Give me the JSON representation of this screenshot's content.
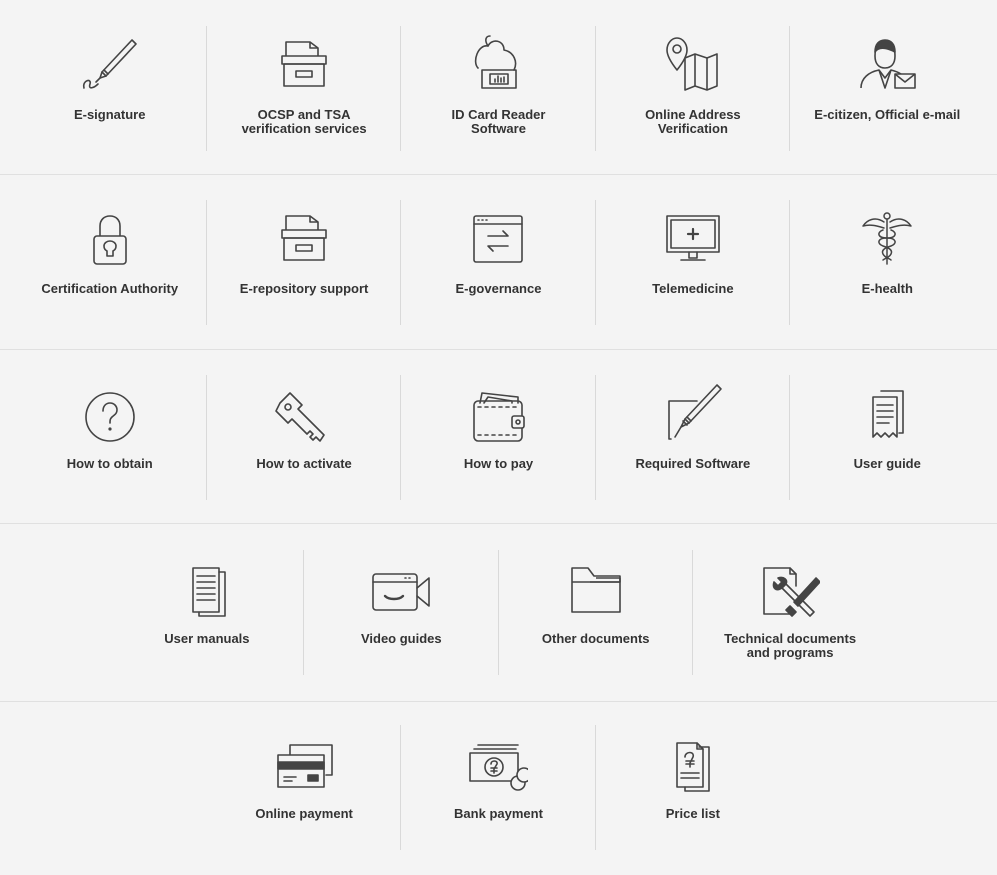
{
  "rows": [
    {
      "items": [
        {
          "label": "E-signature",
          "icon": "pen-signature-icon"
        },
        {
          "label": "OCSP and TSA verification services",
          "icon": "archive-box-icon"
        },
        {
          "label": "ID Card Reader Software",
          "icon": "card-reader-icon"
        },
        {
          "label": "Online Address Verification",
          "icon": "map-pin-icon"
        },
        {
          "label": "E-citizen, Official e-mail",
          "icon": "user-mail-icon"
        }
      ]
    },
    {
      "items": [
        {
          "label": "Certification Authority",
          "icon": "padlock-icon"
        },
        {
          "label": "E-repository support",
          "icon": "archive-box-icon"
        },
        {
          "label": "E-governance",
          "icon": "browser-exchange-icon"
        },
        {
          "label": "Telemedicine",
          "icon": "monitor-plus-icon"
        },
        {
          "label": "E-health",
          "icon": "caduceus-icon"
        }
      ]
    },
    {
      "items": [
        {
          "label": "How to obtain",
          "icon": "question-circle-icon"
        },
        {
          "label": "How to activate",
          "icon": "key-icon"
        },
        {
          "label": "How to pay",
          "icon": "wallet-icon"
        },
        {
          "label": "Required Software",
          "icon": "pen-box-icon"
        },
        {
          "label": "User guide",
          "icon": "receipt-document-icon"
        }
      ]
    },
    {
      "items": [
        {
          "label": "User manuals",
          "icon": "document-stack-icon"
        },
        {
          "label": "Video guides",
          "icon": "video-camera-icon"
        },
        {
          "label": "Other documents",
          "icon": "folder-icon"
        },
        {
          "label": "Technical documents and programs",
          "icon": "document-tools-icon"
        }
      ]
    },
    {
      "items": [
        {
          "label": "Online payment",
          "icon": "credit-card-icon"
        },
        {
          "label": "Bank payment",
          "icon": "bank-cash-icon"
        },
        {
          "label": "Price list",
          "icon": "price-document-icon"
        }
      ]
    }
  ],
  "colors": {
    "background": "#f4f4f4",
    "icon_stroke": "#444444",
    "text": "#333333",
    "divider": "#d9d9d9"
  }
}
